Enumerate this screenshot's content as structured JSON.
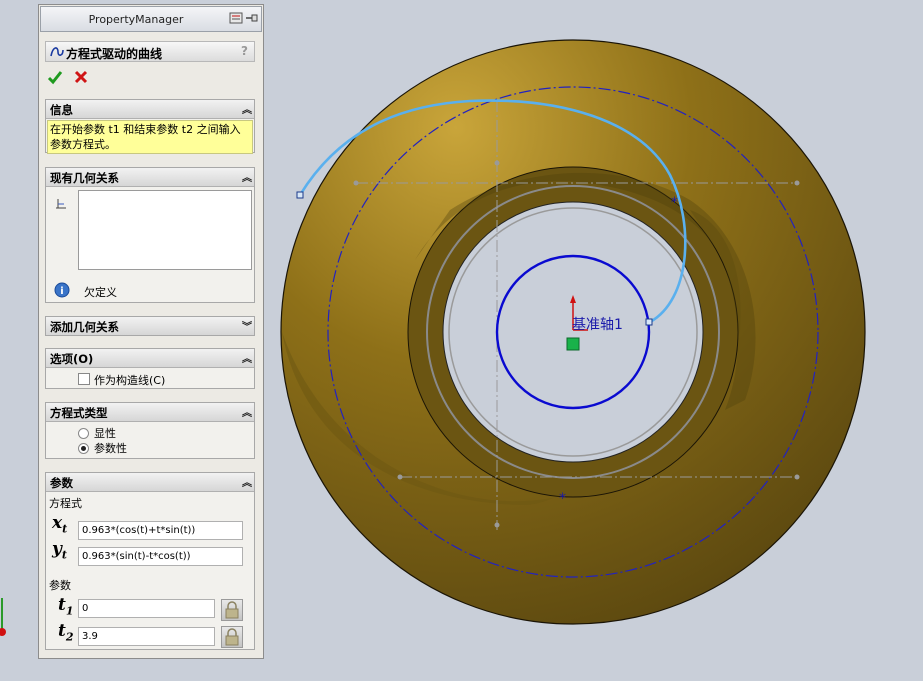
{
  "property_manager": {
    "title": "PropertyManager",
    "feature_title": "方程式驱动的曲线",
    "help": "?",
    "ok_icon": "check-icon",
    "cancel_icon": "x-icon",
    "info": {
      "header": "信息",
      "message": "在开始参数 t1 和结束参数 t2 之间输入参数方程式。"
    },
    "relations": {
      "header": "现有几何关系",
      "status": "欠定义"
    },
    "add_relations": {
      "header": "添加几何关系"
    },
    "options": {
      "header": "选项(O)",
      "construction_label": "作为构造线(C)",
      "construction_checked": false
    },
    "equation_type": {
      "header": "方程式类型",
      "choices": [
        "显性",
        "参数性"
      ],
      "selected": "参数性"
    },
    "parameters": {
      "header": "参数",
      "equation_label": "方程式",
      "xt_var": "x",
      "xt_sub": "t",
      "xt_value": "0.963*(cos(t)+t*sin(t))",
      "yt_var": "y",
      "yt_sub": "t",
      "yt_value": "0.963*(sin(t)-t*cos(t))",
      "param_label": "参数",
      "t1_var": "t",
      "t1_sub": "1",
      "t1_value": "0",
      "t2_var": "t",
      "t2_sub": "2",
      "t2_value": "3.9"
    }
  },
  "viewport": {
    "axis_label": "基准轴1",
    "part_color": "#8a6c12",
    "sketch_color": "#0a0ad0",
    "curve_color": "#5ab0ee"
  }
}
